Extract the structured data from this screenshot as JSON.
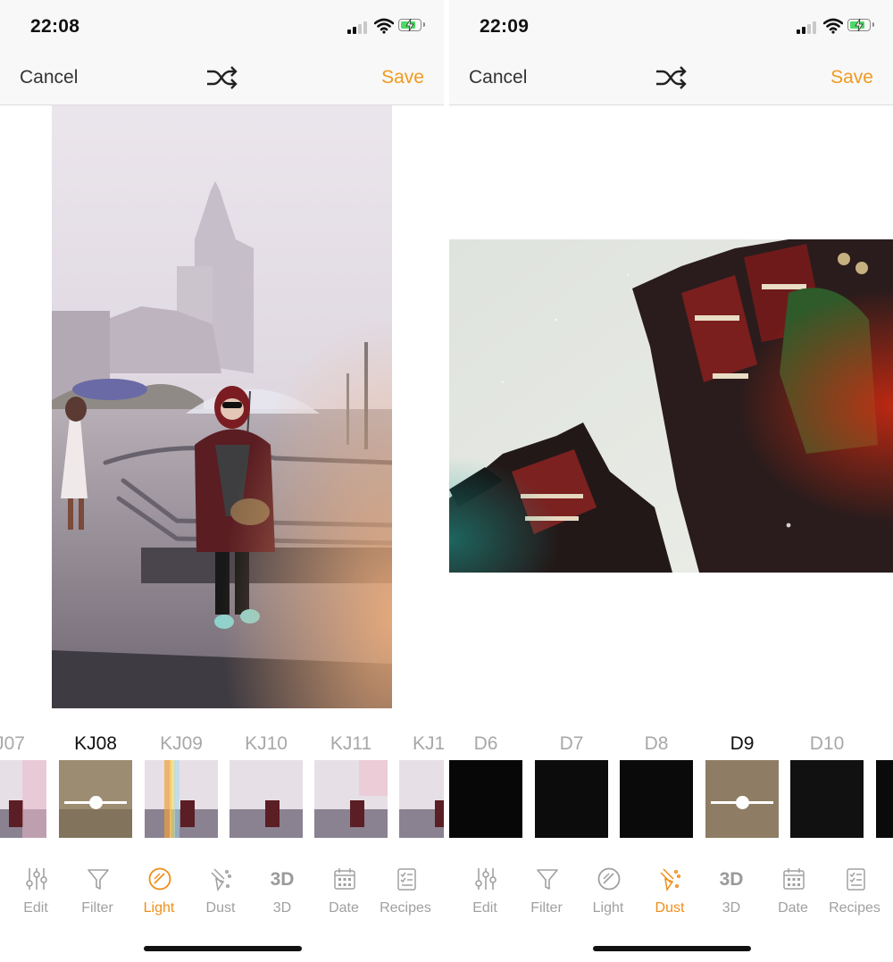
{
  "left": {
    "time": "22:08",
    "cancel_label": "Cancel",
    "save_label": "Save",
    "filters": [
      "J07",
      "KJ08",
      "KJ09",
      "KJ10",
      "KJ11",
      "KJ1"
    ],
    "selected_filter": "KJ08",
    "tabs": [
      {
        "label": "Edit",
        "icon": "sliders-icon"
      },
      {
        "label": "Filter",
        "icon": "funnel-icon"
      },
      {
        "label": "Light",
        "icon": "light-leak-icon"
      },
      {
        "label": "Dust",
        "icon": "dust-icon"
      },
      {
        "label": "3D",
        "icon": "3d-text-icon"
      },
      {
        "label": "Date",
        "icon": "calendar-icon"
      },
      {
        "label": "Recipes",
        "icon": "recipes-icon"
      }
    ],
    "active_tab": "Light"
  },
  "right": {
    "time": "22:09",
    "cancel_label": "Cancel",
    "save_label": "Save",
    "filters": [
      "D6",
      "D7",
      "D8",
      "D9",
      "D10",
      ""
    ],
    "selected_filter": "D9",
    "tabs": [
      {
        "label": "Edit",
        "icon": "sliders-icon"
      },
      {
        "label": "Filter",
        "icon": "funnel-icon"
      },
      {
        "label": "Light",
        "icon": "light-leak-icon"
      },
      {
        "label": "Dust",
        "icon": "dust-icon"
      },
      {
        "label": "3D",
        "icon": "3d-text-icon"
      },
      {
        "label": "Date",
        "icon": "calendar-icon"
      },
      {
        "label": "Recipes",
        "icon": "recipes-icon"
      }
    ],
    "active_tab": "Dust"
  },
  "colors": {
    "accent": "#f19a1e",
    "text": "#333333",
    "inactive": "#a0a0a0"
  }
}
